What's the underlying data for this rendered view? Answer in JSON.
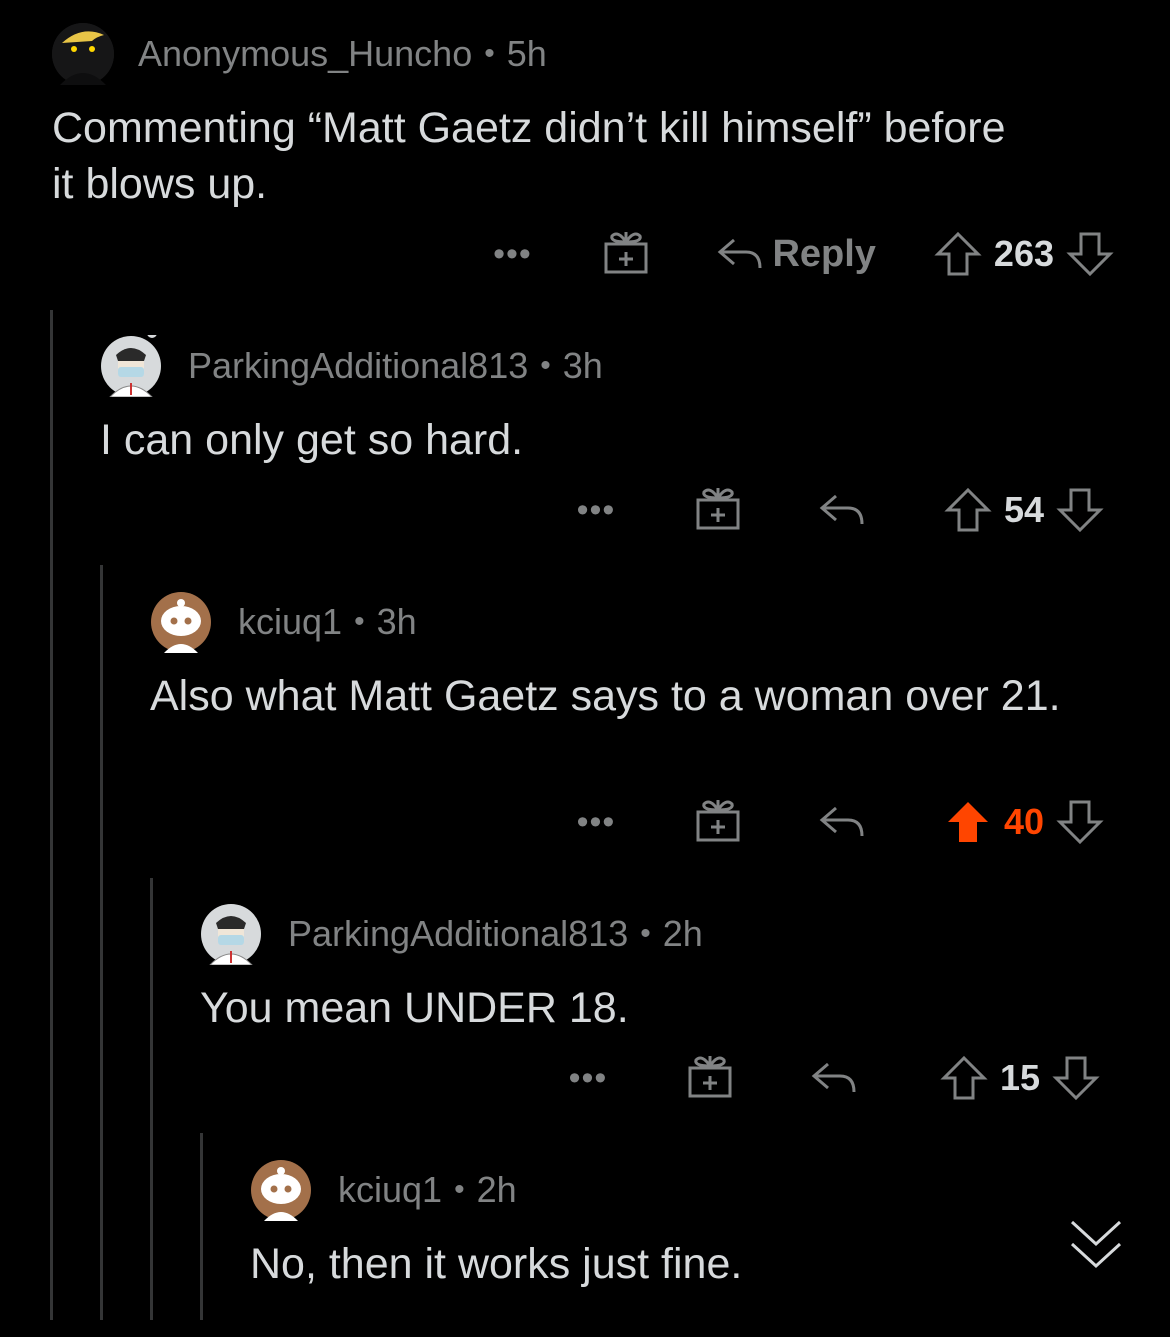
{
  "comments": [
    {
      "username": "Anonymous_Huncho",
      "separator": "•",
      "age": "5h",
      "body": "Commenting “Matt Gaetz didn’t kill himself” before it blows up.",
      "reply_label": "Reply",
      "score": "263",
      "upvoted": false,
      "avatar": "dark-snoo-avatar"
    },
    {
      "username": "ParkingAdditional813",
      "separator": "•",
      "age": "3h",
      "body": "I can only get so hard.",
      "score": "54",
      "upvoted": false,
      "avatar": "masked-doctor-avatar"
    },
    {
      "username": "kciuq1",
      "separator": "•",
      "age": "3h",
      "body": "Also what Matt Gaetz says to a woman over 21.",
      "score": "40",
      "upvoted": true,
      "avatar": "brown-snoo-avatar"
    },
    {
      "username": "ParkingAdditional813",
      "separator": "•",
      "age": "2h",
      "body": "You mean UNDER 18.",
      "score": "15",
      "upvoted": false,
      "avatar": "masked-doctor-avatar"
    },
    {
      "username": "kciuq1",
      "separator": "•",
      "age": "2h",
      "body": "No, then it works just fine.",
      "avatar": "brown-snoo-avatar"
    }
  ],
  "actions": {
    "more_label": "•••"
  },
  "colors": {
    "background": "#000000",
    "text": "#d7dadc",
    "muted": "#818384",
    "upvote": "#ff4500",
    "thread_line": "#343536"
  }
}
